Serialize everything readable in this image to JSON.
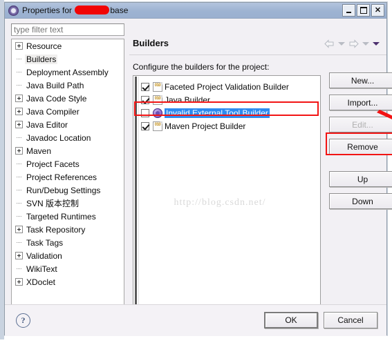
{
  "window": {
    "title_prefix": "Properties for",
    "title_suffix": "base",
    "title_icon": "eclipse-properties-icon",
    "controls": {
      "minimize": "Minimize",
      "maximize": "Maximize",
      "close": "Close"
    }
  },
  "filter": {
    "placeholder": "type filter text",
    "value": ""
  },
  "tree": {
    "items": [
      {
        "label": "Resource",
        "expandable": true,
        "selected": false
      },
      {
        "label": "Builders",
        "expandable": false,
        "selected": true
      },
      {
        "label": "Deployment Assembly",
        "expandable": false,
        "selected": false
      },
      {
        "label": "Java Build Path",
        "expandable": false,
        "selected": false
      },
      {
        "label": "Java Code Style",
        "expandable": true,
        "selected": false
      },
      {
        "label": "Java Compiler",
        "expandable": true,
        "selected": false
      },
      {
        "label": "Java Editor",
        "expandable": true,
        "selected": false
      },
      {
        "label": "Javadoc Location",
        "expandable": false,
        "selected": false
      },
      {
        "label": "Maven",
        "expandable": true,
        "selected": false
      },
      {
        "label": "Project Facets",
        "expandable": false,
        "selected": false
      },
      {
        "label": "Project References",
        "expandable": false,
        "selected": false
      },
      {
        "label": "Run/Debug Settings",
        "expandable": false,
        "selected": false
      },
      {
        "label": "SVN 版本控制",
        "expandable": false,
        "selected": false
      },
      {
        "label": "Targeted Runtimes",
        "expandable": false,
        "selected": false
      },
      {
        "label": "Task Repository",
        "expandable": true,
        "selected": false
      },
      {
        "label": "Task Tags",
        "expandable": false,
        "selected": false
      },
      {
        "label": "Validation",
        "expandable": true,
        "selected": false
      },
      {
        "label": "WikiText",
        "expandable": false,
        "selected": false
      },
      {
        "label": "XDoclet",
        "expandable": true,
        "selected": false
      }
    ]
  },
  "page": {
    "title": "Builders",
    "description": "Configure the builders for the project:"
  },
  "nav": {
    "back_icon": "back-arrow-icon",
    "back_menu_icon": "chevron-down-icon",
    "forward_icon": "forward-arrow-icon",
    "forward_menu_icon": "chevron-down-icon",
    "view_menu_icon": "view-menu-caret-icon"
  },
  "builders": [
    {
      "label": "Faceted Project Validation Builder",
      "checked": true,
      "selected": false,
      "icon": "builder-file-icon"
    },
    {
      "label": "Java Builder",
      "checked": true,
      "selected": false,
      "icon": "builder-file-icon"
    },
    {
      "label": "Invalid External Tool Builder",
      "checked": false,
      "selected": true,
      "icon": "invalid-builder-icon"
    },
    {
      "label": "Maven Project Builder",
      "checked": true,
      "selected": false,
      "icon": "builder-file-icon"
    }
  ],
  "side_buttons": [
    {
      "label": "New...",
      "enabled": true,
      "highlighted": false
    },
    {
      "label": "Import...",
      "enabled": true,
      "highlighted": false
    },
    {
      "label": "Edit...",
      "enabled": false,
      "highlighted": false
    },
    {
      "label": "Remove",
      "enabled": true,
      "highlighted": true
    },
    {
      "label": "Up",
      "enabled": true,
      "highlighted": false
    },
    {
      "label": "Down",
      "enabled": true,
      "highlighted": false
    }
  ],
  "watermark": {
    "text": "http://blog.csdn.net/"
  },
  "footer": {
    "help_icon": "help-question-icon",
    "ok_label": "OK",
    "cancel_label": "Cancel"
  },
  "annotation": {
    "arrow_color": "#f21313",
    "highlight_color": "#f21313",
    "selection_color": "#2d8bf0",
    "redaction_color": "#f10505"
  }
}
